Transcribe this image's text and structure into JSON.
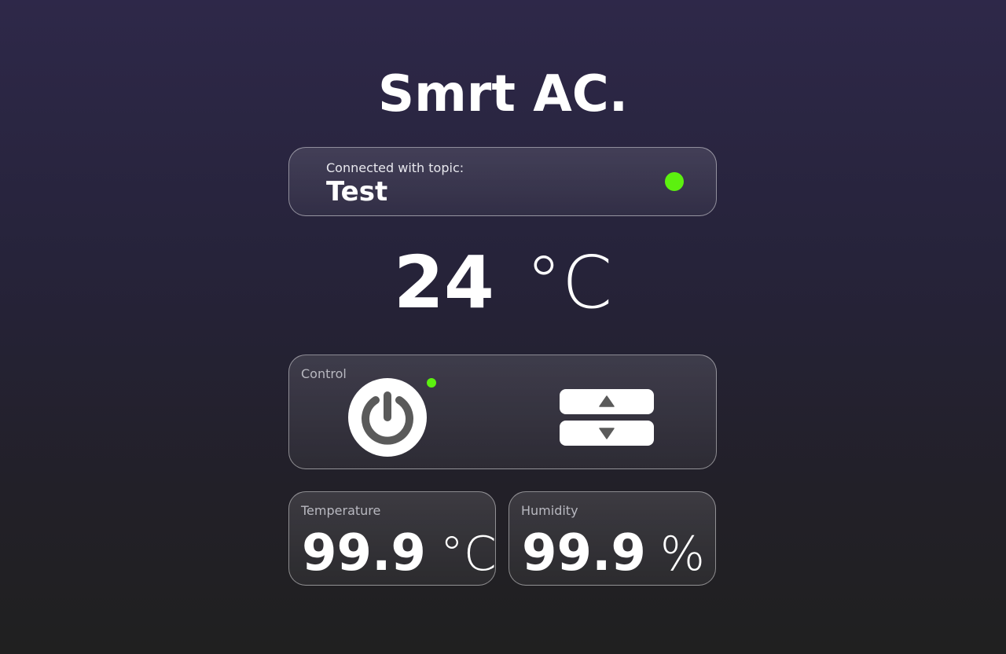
{
  "app": {
    "title": "Smrt AC."
  },
  "connection": {
    "label": "Connected with topic:",
    "topic": "Test",
    "status_color": "#5cf10f"
  },
  "setpoint": {
    "value": "24",
    "unit": "°C"
  },
  "control": {
    "label": "Control",
    "power_icon": "power-icon",
    "power_on": true,
    "up_icon": "triangle-up-icon",
    "down_icon": "triangle-down-icon"
  },
  "sensors": {
    "temperature": {
      "label": "Temperature",
      "value": "99.9",
      "unit": "°C"
    },
    "humidity": {
      "label": "Humidity",
      "value": "99.9",
      "unit": "%"
    }
  },
  "colors": {
    "accent_green": "#5cf10f",
    "icon_gray": "#5a5a5a"
  }
}
